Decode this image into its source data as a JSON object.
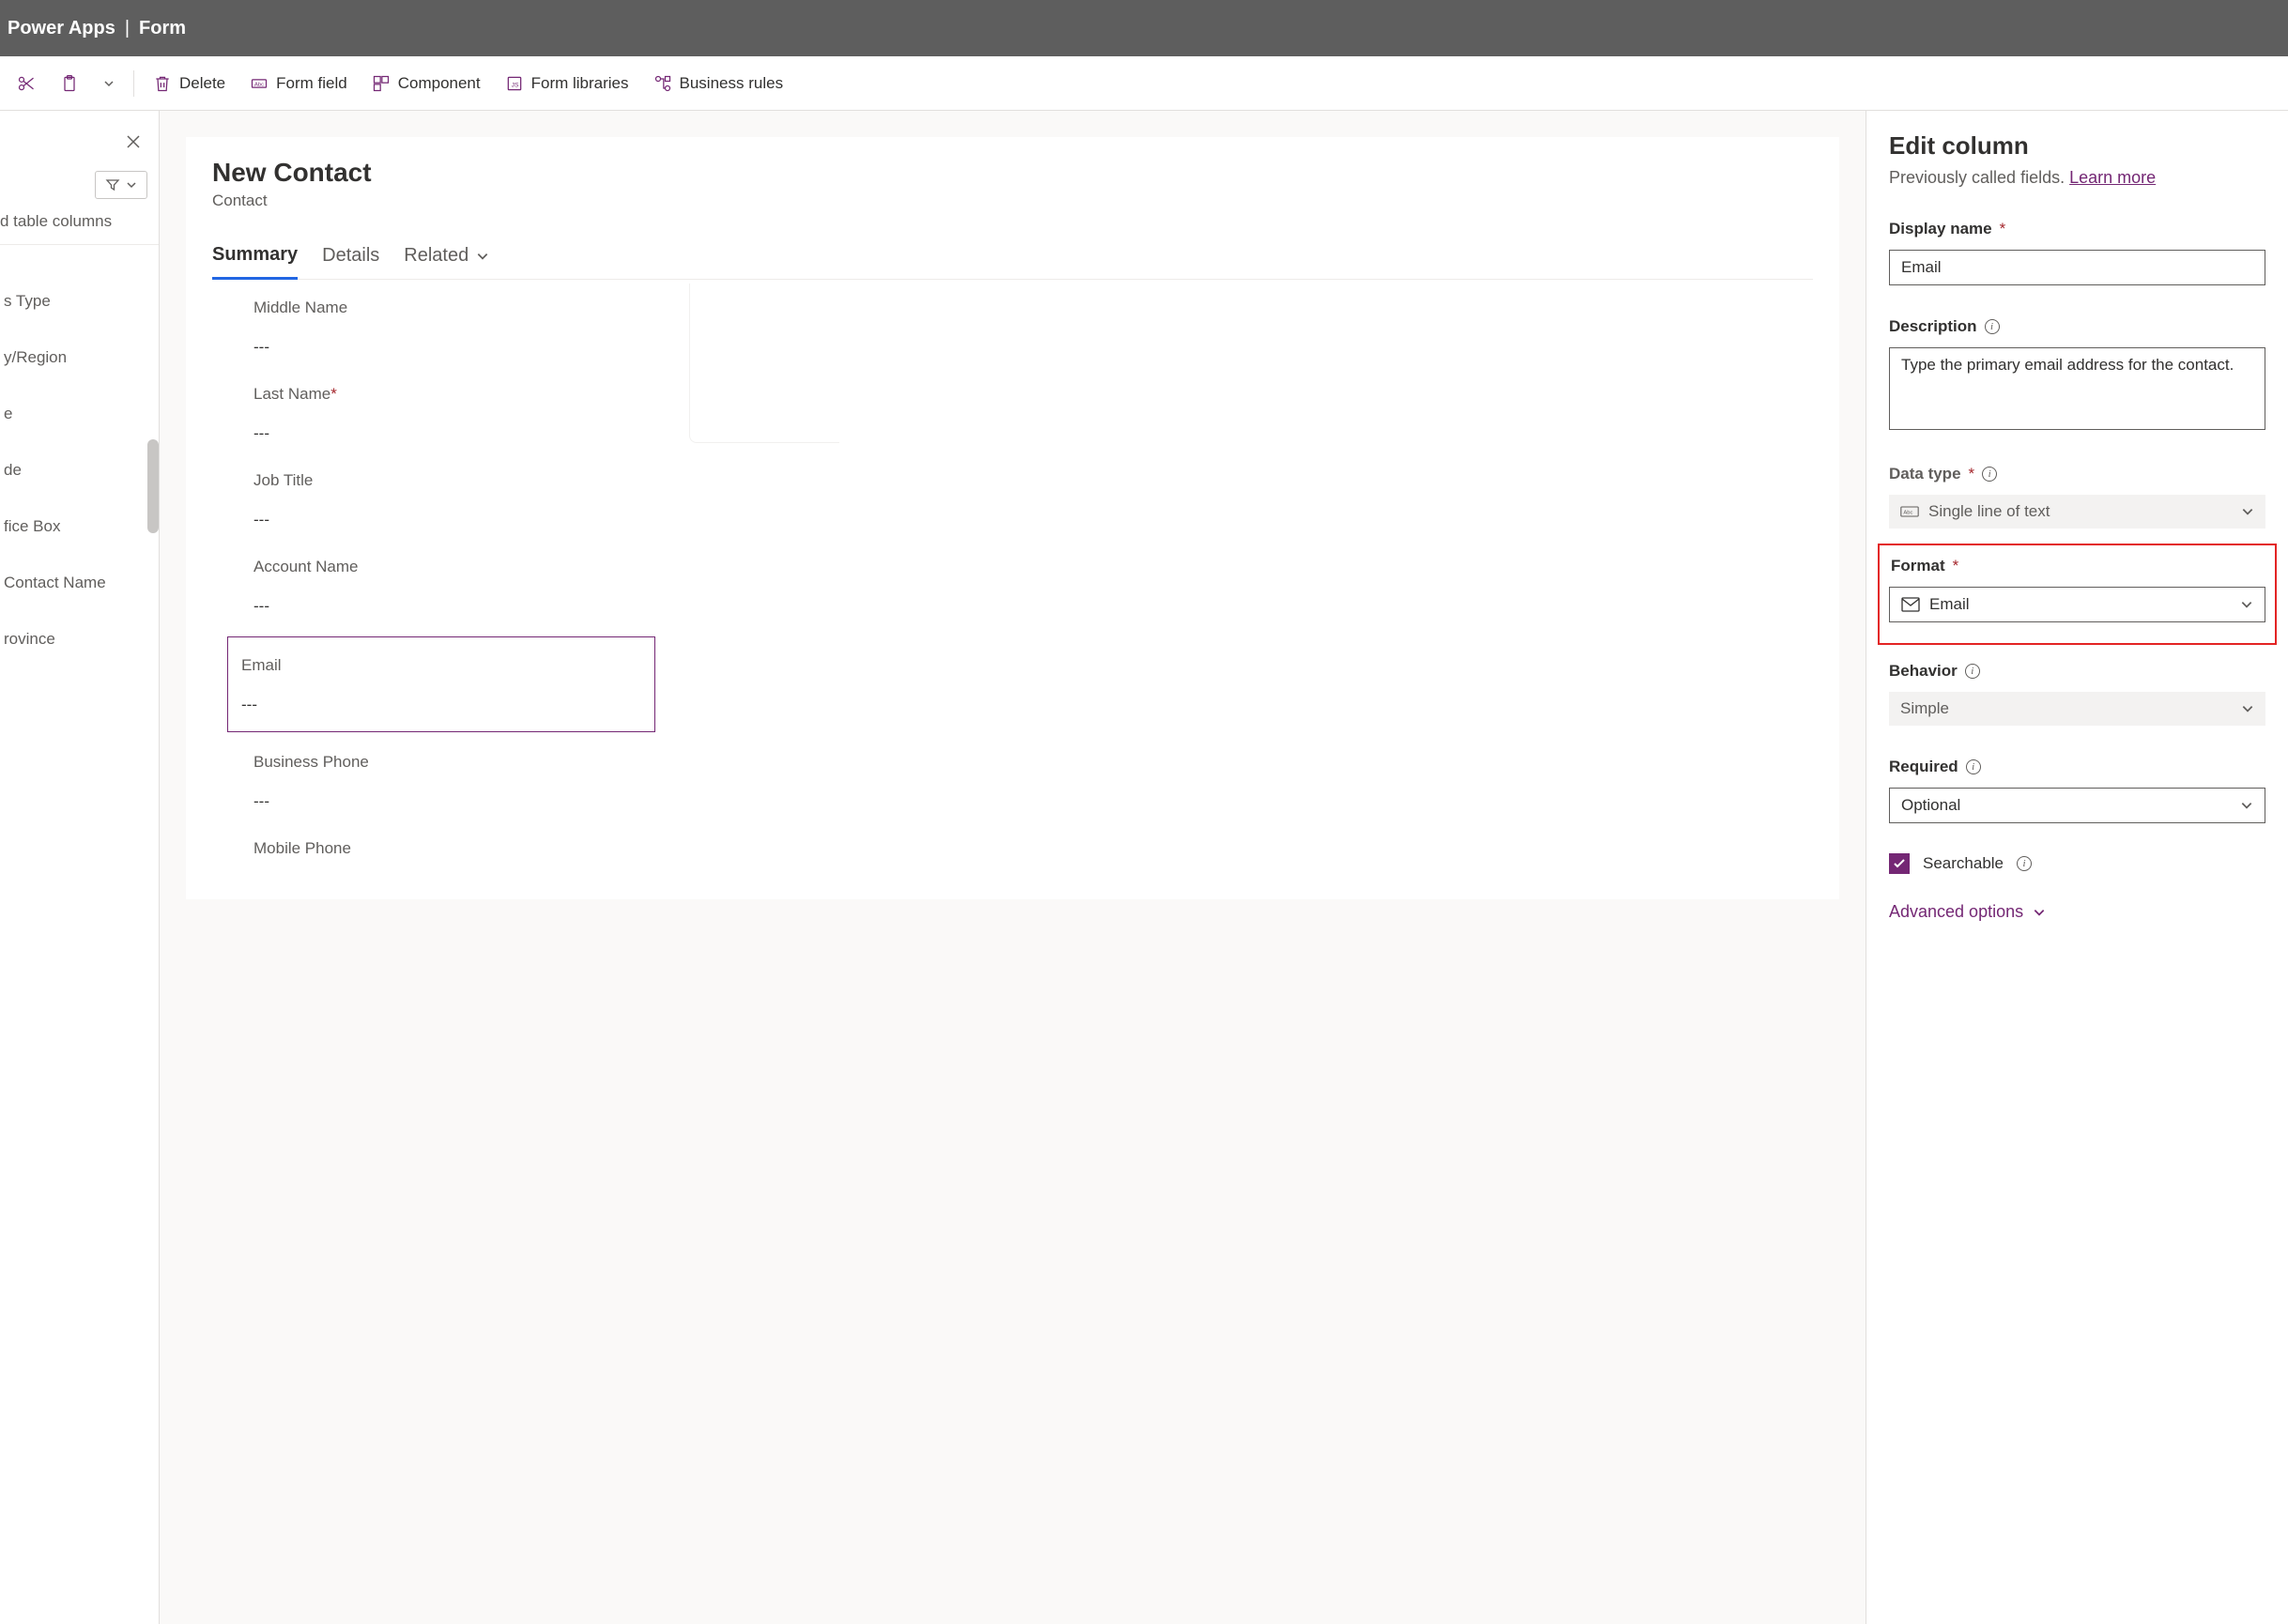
{
  "header": {
    "app": "Power Apps",
    "page": "Form"
  },
  "toolbar": {
    "delete": "Delete",
    "formField": "Form field",
    "component": "Component",
    "formLibraries": "Form libraries",
    "businessRules": "Business rules"
  },
  "leftPane": {
    "sectionLabel": "d table columns",
    "items": [
      "s Type",
      "y/Region",
      "e",
      "de",
      "fice Box",
      "Contact Name",
      "rovince"
    ]
  },
  "form": {
    "title": "New Contact",
    "subtitle": "Contact",
    "tabs": {
      "summary": "Summary",
      "details": "Details",
      "related": "Related"
    },
    "fields": [
      {
        "label": "Middle Name",
        "required": false,
        "value": "---",
        "selected": false
      },
      {
        "label": "Last Name",
        "required": true,
        "value": "---",
        "selected": false
      },
      {
        "label": "Job Title",
        "required": false,
        "value": "---",
        "selected": false
      },
      {
        "label": "Account Name",
        "required": false,
        "value": "---",
        "selected": false
      },
      {
        "label": "Email",
        "required": false,
        "value": "---",
        "selected": true
      },
      {
        "label": "Business Phone",
        "required": false,
        "value": "---",
        "selected": false
      },
      {
        "label": "Mobile Phone",
        "required": false,
        "value": "",
        "selected": false
      }
    ]
  },
  "panel": {
    "title": "Edit column",
    "subtitle": "Previously called fields.",
    "learnMore": "Learn more",
    "displayName": {
      "label": "Display name",
      "value": "Email"
    },
    "description": {
      "label": "Description",
      "value": "Type the primary email address for the contact."
    },
    "dataType": {
      "label": "Data type",
      "value": "Single line of text"
    },
    "format": {
      "label": "Format",
      "value": "Email"
    },
    "behavior": {
      "label": "Behavior",
      "value": "Simple"
    },
    "required": {
      "label": "Required",
      "value": "Optional"
    },
    "searchable": "Searchable",
    "advanced": "Advanced options"
  }
}
